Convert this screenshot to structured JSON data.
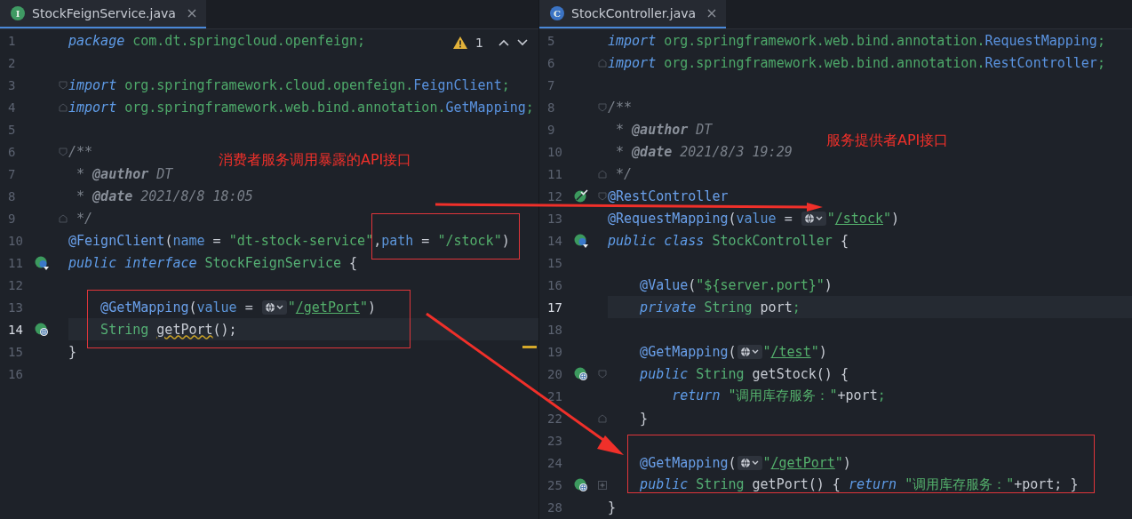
{
  "panes": [
    {
      "tab": {
        "label": "StockFeignService.java",
        "icon_letter": "I",
        "kind": "interface",
        "selected": true
      },
      "inspection": {
        "count": "1"
      },
      "lines": [
        {
          "number": "1",
          "current": false,
          "tokens": [
            {
              "kind": "kw",
              "text": "package "
            },
            {
              "kind": "pkg",
              "text": "com.dt.springcloud.openfeign;"
            }
          ]
        },
        {
          "number": "2",
          "current": false
        },
        {
          "number": "3",
          "current": false,
          "fold": {
            "kind": "open"
          },
          "tokens": [
            {
              "kind": "kw",
              "text": "import "
            },
            {
              "kind": "pkg",
              "text": "org.springframework.cloud.openfeign."
            },
            {
              "kind": "cls",
              "text": "FeignClient"
            },
            {
              "kind": "pkg",
              "text": ";"
            }
          ]
        },
        {
          "number": "4",
          "current": false,
          "fold": {
            "kind": "close"
          },
          "tokens": [
            {
              "kind": "kw",
              "text": "import "
            },
            {
              "kind": "pkg",
              "text": "org.springframework.web.bind.annotation."
            },
            {
              "kind": "cls",
              "text": "GetMapping"
            },
            {
              "kind": "pkg",
              "text": ";"
            }
          ]
        },
        {
          "number": "5",
          "current": false
        },
        {
          "number": "6",
          "current": false,
          "fold": {
            "kind": "open"
          },
          "tokens": [
            {
              "kind": "cmt",
              "text": "/**"
            }
          ]
        },
        {
          "number": "7",
          "current": false,
          "tokens": [
            {
              "kind": "cmt",
              "text": " * "
            },
            {
              "kind": "doc",
              "text": "@author"
            },
            {
              "kind": "cmt",
              "text": " DT"
            }
          ]
        },
        {
          "number": "8",
          "current": false,
          "tokens": [
            {
              "kind": "cmt",
              "text": " * "
            },
            {
              "kind": "doc",
              "text": "@date"
            },
            {
              "kind": "cmt",
              "text": " 2021/8/8 18:05"
            }
          ]
        },
        {
          "number": "9",
          "current": false,
          "fold": {
            "kind": "close"
          },
          "tokens": [
            {
              "kind": "cmt",
              "text": " */"
            }
          ]
        },
        {
          "number": "10",
          "current": false,
          "tokens": [
            {
              "kind": "ann",
              "text": "@FeignClient"
            },
            {
              "kind": "plain",
              "text": "("
            },
            {
              "kind": "param",
              "text": "name"
            },
            {
              "kind": "plain",
              "text": " = "
            },
            {
              "kind": "str",
              "text": "\"dt-stock-service\""
            },
            {
              "kind": "plain",
              "text": ","
            },
            {
              "kind": "param",
              "text": "path"
            },
            {
              "kind": "plain",
              "text": " = "
            },
            {
              "kind": "str",
              "text": "\"/stock\""
            },
            {
              "kind": "plain",
              "text": ")"
            }
          ]
        },
        {
          "number": "11",
          "current": false,
          "gutter": {
            "kind": "interface"
          },
          "tokens": [
            {
              "kind": "kw",
              "text": "public interface "
            },
            {
              "kind": "type",
              "text": "StockFeignService"
            },
            {
              "kind": "plain",
              "text": " {"
            }
          ]
        },
        {
          "number": "12",
          "current": false
        },
        {
          "number": "13",
          "current": false,
          "tokens": [
            {
              "kind": "ann",
              "text": "    @GetMapping"
            },
            {
              "kind": "plain",
              "text": "("
            },
            {
              "kind": "param",
              "text": "value"
            },
            {
              "kind": "plain",
              "text": " = "
            },
            {
              "kind": "inlay"
            },
            {
              "kind": "str",
              "text": "\""
            },
            {
              "kind": "url",
              "text": "/getPort"
            },
            {
              "kind": "str",
              "text": "\""
            },
            {
              "kind": "plain",
              "text": ")"
            }
          ]
        },
        {
          "number": "14",
          "current": true,
          "gutter": {
            "kind": "web"
          },
          "tokens": [
            {
              "kind": "type",
              "text": "    String "
            },
            {
              "kind": "warn",
              "text": "getPort"
            },
            {
              "kind": "plain",
              "text": "();"
            }
          ]
        },
        {
          "number": "15",
          "current": false,
          "tokens": [
            {
              "kind": "plain",
              "text": "}"
            }
          ]
        },
        {
          "number": "16",
          "current": false
        }
      ]
    },
    {
      "tab": {
        "label": "StockController.java",
        "icon_letter": "C",
        "kind": "class",
        "selected": true
      },
      "lines": [
        {
          "number": "5",
          "current": false,
          "tokens": [
            {
              "kind": "kw",
              "text": "import "
            },
            {
              "kind": "pkg",
              "text": "org.springframework.web.bind.annotation."
            },
            {
              "kind": "cls",
              "text": "RequestMapping"
            },
            {
              "kind": "pkg",
              "text": ";"
            }
          ]
        },
        {
          "number": "6",
          "current": false,
          "fold": {
            "kind": "close"
          },
          "tokens": [
            {
              "kind": "kw",
              "text": "import "
            },
            {
              "kind": "pkg",
              "text": "org.springframework.web.bind.annotation."
            },
            {
              "kind": "cls",
              "text": "RestController"
            },
            {
              "kind": "pkg",
              "text": ";"
            }
          ]
        },
        {
          "number": "7",
          "current": false
        },
        {
          "number": "8",
          "current": false,
          "fold": {
            "kind": "open"
          },
          "tokens": [
            {
              "kind": "cmt",
              "text": "/**"
            }
          ]
        },
        {
          "number": "9",
          "current": false,
          "tokens": [
            {
              "kind": "cmt",
              "text": " * "
            },
            {
              "kind": "doc",
              "text": "@author"
            },
            {
              "kind": "cmt",
              "text": " DT"
            }
          ]
        },
        {
          "number": "10",
          "current": false,
          "tokens": [
            {
              "kind": "cmt",
              "text": " * "
            },
            {
              "kind": "doc",
              "text": "@date"
            },
            {
              "kind": "cmt",
              "text": " 2021/8/3 19:29"
            }
          ]
        },
        {
          "number": "11",
          "current": false,
          "fold": {
            "kind": "close"
          },
          "tokens": [
            {
              "kind": "cmt",
              "text": " */"
            }
          ]
        },
        {
          "number": "12",
          "current": false,
          "gutter": {
            "kind": "bean"
          },
          "fold": {
            "kind": "open"
          },
          "tokens": [
            {
              "kind": "ann",
              "text": "@RestController"
            }
          ]
        },
        {
          "number": "13",
          "current": false,
          "tokens": [
            {
              "kind": "ann",
              "text": "@RequestMapping"
            },
            {
              "kind": "plain",
              "text": "("
            },
            {
              "kind": "param",
              "text": "value"
            },
            {
              "kind": "plain",
              "text": " = "
            },
            {
              "kind": "inlay"
            },
            {
              "kind": "str",
              "text": "\""
            },
            {
              "kind": "url",
              "text": "/stock"
            },
            {
              "kind": "str",
              "text": "\""
            },
            {
              "kind": "plain",
              "text": ")"
            }
          ]
        },
        {
          "number": "14",
          "current": false,
          "gutter": {
            "kind": "interface"
          },
          "tokens": [
            {
              "kind": "kw",
              "text": "public class "
            },
            {
              "kind": "type",
              "text": "StockController"
            },
            {
              "kind": "plain",
              "text": " {"
            }
          ]
        },
        {
          "number": "15",
          "current": false
        },
        {
          "number": "16",
          "current": false,
          "tokens": [
            {
              "kind": "ann",
              "text": "    @Value"
            },
            {
              "kind": "plain",
              "text": "("
            },
            {
              "kind": "str",
              "text": "\"${server.port}\""
            },
            {
              "kind": "plain",
              "text": ")"
            }
          ]
        },
        {
          "number": "17",
          "current": true,
          "tokens": [
            {
              "kind": "kw",
              "text": "    private "
            },
            {
              "kind": "type",
              "text": "String "
            },
            {
              "kind": "plain",
              "text": "port"
            },
            {
              "kind": "pkg",
              "text": ";"
            }
          ]
        },
        {
          "number": "18",
          "current": false
        },
        {
          "number": "19",
          "current": false,
          "tokens": [
            {
              "kind": "ann",
              "text": "    @GetMapping"
            },
            {
              "kind": "plain",
              "text": "("
            },
            {
              "kind": "inlay"
            },
            {
              "kind": "str",
              "text": "\""
            },
            {
              "kind": "url",
              "text": "/test"
            },
            {
              "kind": "str",
              "text": "\""
            },
            {
              "kind": "plain",
              "text": ")"
            }
          ]
        },
        {
          "number": "20",
          "current": false,
          "gutter": {
            "kind": "web"
          },
          "fold": {
            "kind": "open"
          },
          "tokens": [
            {
              "kind": "kw",
              "text": "    public "
            },
            {
              "kind": "type",
              "text": "String "
            },
            {
              "kind": "plain",
              "text": "getStock() {"
            }
          ]
        },
        {
          "number": "21",
          "current": false,
          "tokens": [
            {
              "kind": "kw",
              "text": "        return "
            },
            {
              "kind": "str",
              "text": "\"调用库存服务：\""
            },
            {
              "kind": "plain",
              "text": "+port"
            },
            {
              "kind": "pkg",
              "text": ";"
            }
          ]
        },
        {
          "number": "22",
          "current": false,
          "fold": {
            "kind": "close"
          },
          "tokens": [
            {
              "kind": "plain",
              "text": "    }"
            }
          ]
        },
        {
          "number": "23",
          "current": false
        },
        {
          "number": "24",
          "current": false,
          "tokens": [
            {
              "kind": "ann",
              "text": "    @GetMapping"
            },
            {
              "kind": "plain",
              "text": "("
            },
            {
              "kind": "inlay"
            },
            {
              "kind": "str",
              "text": "\""
            },
            {
              "kind": "url",
              "text": "/getPort"
            },
            {
              "kind": "str",
              "text": "\""
            },
            {
              "kind": "plain",
              "text": ")"
            }
          ]
        },
        {
          "number": "25",
          "current": false,
          "gutter": {
            "kind": "web"
          },
          "fold": {
            "kind": "collapsed"
          },
          "tokens": [
            {
              "kind": "kw",
              "text": "    public "
            },
            {
              "kind": "type",
              "text": "String "
            },
            {
              "kind": "plain",
              "text": "getPort() { "
            },
            {
              "kind": "kw",
              "text": "return "
            },
            {
              "kind": "str",
              "text": "\"调用库存服务：\""
            },
            {
              "kind": "plain",
              "text": "+port; }"
            }
          ]
        },
        {
          "number": "28",
          "current": false,
          "tokens": [
            {
              "kind": "plain",
              "text": "}"
            }
          ]
        }
      ]
    }
  ],
  "callouts": [
    {
      "text": "消费者服务调用暴露的API接口"
    },
    {
      "text": "服务提供者API接口"
    }
  ]
}
